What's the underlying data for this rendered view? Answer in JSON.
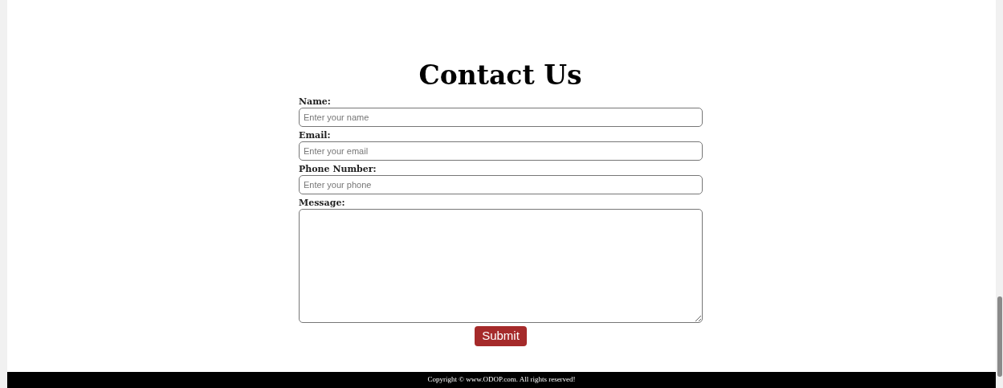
{
  "heading": "Contact Us",
  "fields": [
    {
      "kind": "input",
      "label": "Name:",
      "placeholder": "Enter your name"
    },
    {
      "kind": "input",
      "label": "Email:",
      "placeholder": "Enter your email"
    },
    {
      "kind": "input",
      "label": "Phone Number:",
      "placeholder": "Enter your phone"
    },
    {
      "kind": "textarea",
      "label": "Message:"
    }
  ],
  "submit": "Submit",
  "footer": "Copyright © www.ODOP.com. All rights reserved!"
}
